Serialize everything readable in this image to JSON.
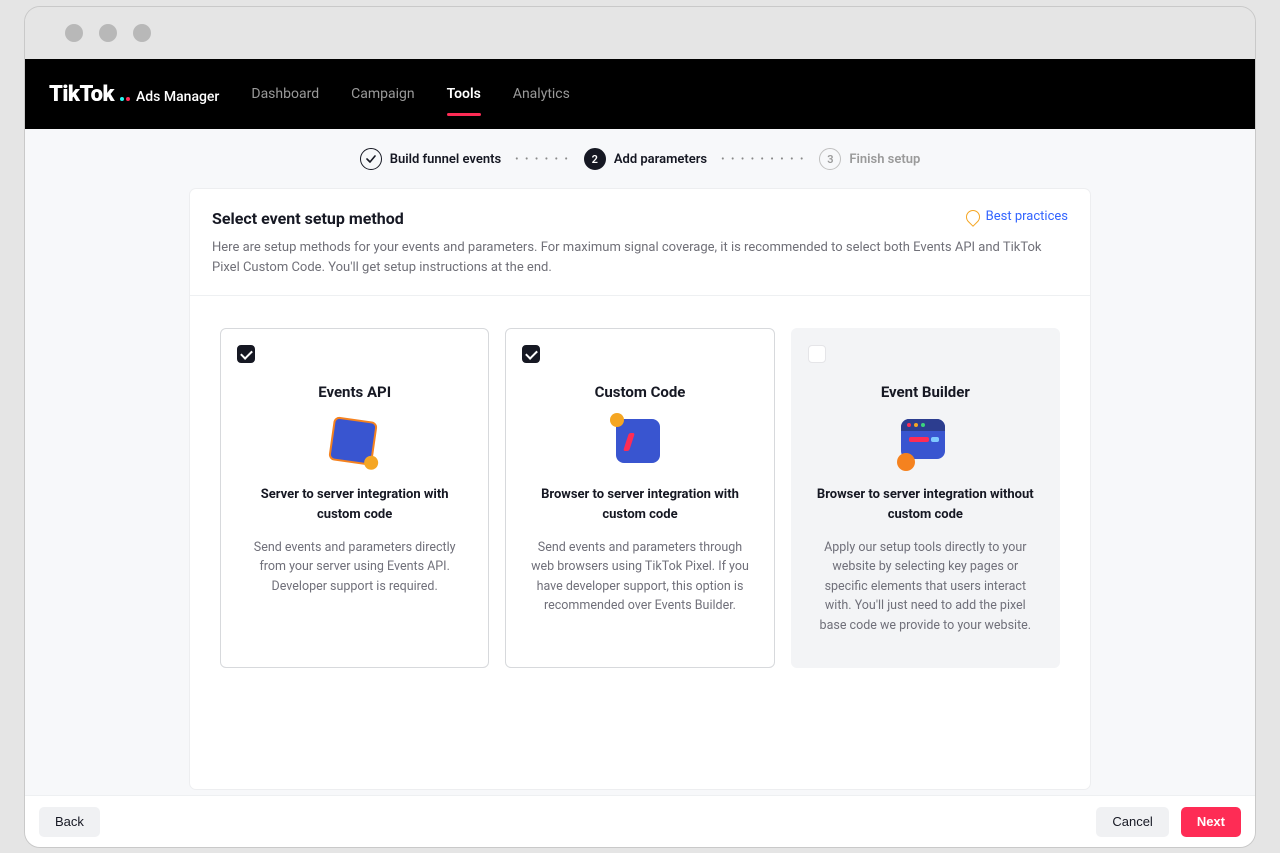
{
  "brand": {
    "logo": "TikTok",
    "sub": "Ads Manager"
  },
  "nav": {
    "items": [
      {
        "label": "Dashboard",
        "active": false
      },
      {
        "label": "Campaign",
        "active": false
      },
      {
        "label": "Tools",
        "active": true
      },
      {
        "label": "Analytics",
        "active": false
      }
    ]
  },
  "stepper": {
    "steps": [
      {
        "label": "Build funnel events",
        "state": "done"
      },
      {
        "label": "Add parameters",
        "state": "current",
        "number": "2"
      },
      {
        "label": "Finish setup",
        "state": "upcoming",
        "number": "3"
      }
    ]
  },
  "panel": {
    "title": "Select event setup method",
    "best_practices": "Best practices",
    "description": "Here are setup methods for your events and parameters. For maximum signal coverage, it is recommended to select both Events API and TikTok Pixel Custom Code. You'll get setup instructions at the end."
  },
  "options": [
    {
      "id": "events-api",
      "title": "Events API",
      "subtitle": "Server to server integration with custom code",
      "description": "Send events and parameters directly from your server using Events API. Developer support is required.",
      "checked": true,
      "disabled": false,
      "icon": "cube-icon"
    },
    {
      "id": "custom-code",
      "title": "Custom Code",
      "subtitle": "Browser to server integration with custom code",
      "description": "Send events and parameters through web browsers using TikTok Pixel. If you have developer support, this option is recommended over Events Builder.",
      "checked": true,
      "disabled": false,
      "icon": "code-icon"
    },
    {
      "id": "event-builder",
      "title": "Event Builder",
      "subtitle": "Browser to server integration without custom code",
      "description": "Apply our setup tools directly to your website by selecting key pages or specific elements that users interact with. You'll just need to add the pixel base code we provide to your website.",
      "checked": false,
      "disabled": true,
      "icon": "window-icon"
    }
  ],
  "footer": {
    "back": "Back",
    "cancel": "Cancel",
    "next": "Next"
  }
}
